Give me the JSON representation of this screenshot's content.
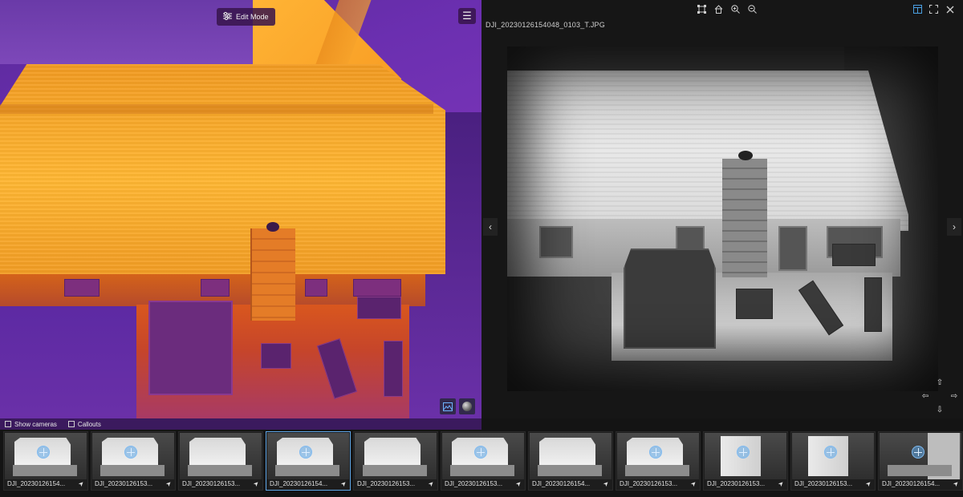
{
  "left_viewer": {
    "edit_mode_label": "Edit Mode",
    "edit_mode_icon": "sliders-icon",
    "menu_icon": "hamburger-menu-icon",
    "overlay_buttons": [
      "image-layer-icon",
      "sphere-icon"
    ],
    "options": [
      {
        "label": "Show cameras",
        "checked": false
      },
      {
        "label": "Callouts",
        "checked": false
      }
    ],
    "palette": {
      "hot": "#ffb433",
      "warm": "#d4631a",
      "cool": "#6b2fb0"
    }
  },
  "right_viewer": {
    "filename": "DJI_20230126154048_0103_T.JPG",
    "center_tools": [
      "select-frame-icon",
      "home-icon",
      "zoom-in-icon",
      "zoom-out-icon"
    ],
    "right_tools": [
      "split-view-icon",
      "fullscreen-icon",
      "close-icon"
    ],
    "nav_prev": "‹",
    "nav_next": "›"
  },
  "filmstrip": {
    "accent_color": "#5fa7e8",
    "thumbnails": [
      {
        "label": "DJI_20230126154...",
        "selected": false,
        "style": "house",
        "target": true
      },
      {
        "label": "DJI_20230126153...",
        "selected": false,
        "style": "house",
        "target": true
      },
      {
        "label": "DJI_20230126153...",
        "selected": false,
        "style": "house",
        "target": false
      },
      {
        "label": "DJI_20230126154...",
        "selected": true,
        "style": "house",
        "target": true
      },
      {
        "label": "DJI_20230126153...",
        "selected": false,
        "style": "house",
        "target": false
      },
      {
        "label": "DJI_20230126153...",
        "selected": false,
        "style": "house",
        "target": true
      },
      {
        "label": "DJI_20230126154...",
        "selected": false,
        "style": "house",
        "target": false
      },
      {
        "label": "DJI_20230126153...",
        "selected": false,
        "style": "house",
        "target": true
      },
      {
        "label": "DJI_20230126153...",
        "selected": false,
        "style": "box",
        "target": true
      },
      {
        "label": "DJI_20230126153...",
        "selected": false,
        "style": "box",
        "target": true
      },
      {
        "label": "DJI_20230126154...",
        "selected": false,
        "style": "side",
        "target": true
      }
    ]
  }
}
